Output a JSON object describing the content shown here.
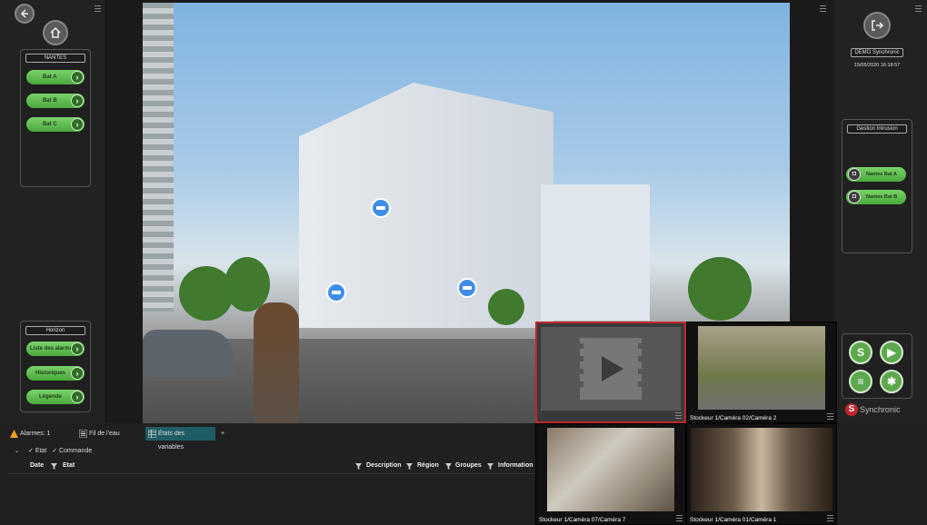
{
  "left": {
    "site_group_title": "NANTES",
    "site_buttons": [
      "Bat A",
      "Bat B",
      "Bat C"
    ],
    "horizon_title": "Horizon",
    "horizon_buttons": [
      "Liste des alarmes",
      "Historiques",
      "Légende"
    ]
  },
  "right": {
    "user_label": "DEMO Synchronic",
    "datetime": "15/05/2020 16:18:57",
    "intrusion_title": "Gestion Intrusion",
    "intrusion_buttons": [
      "Nantes Bat A",
      "Nantes Bat B"
    ],
    "brand": "Synchronic",
    "brand_colors": {
      "primary": "#c0272d",
      "text": "#bbbbbb"
    }
  },
  "bottom": {
    "tabs": [
      {
        "label": "Alarmes: 1",
        "icon": "warning-icon"
      },
      {
        "label": "Fil de l'eau",
        "icon": "list-icon"
      },
      {
        "label": "États des variables",
        "icon": "table-icon"
      },
      {
        "label": "+",
        "icon": ""
      }
    ],
    "filters": {
      "etat": "Etat",
      "commande": "Commande"
    },
    "columns": [
      "Date",
      "Etat",
      "Description",
      "Région",
      "Groupes",
      "Information"
    ]
  },
  "videos": [
    {
      "caption": "",
      "state": "placeholder"
    },
    {
      "caption": "Stockeur 1/Caméra 02/Caméra 2"
    },
    {
      "caption": "Stockeur 1/Caméra 07/Caméra 7"
    },
    {
      "caption": "Stockeur 1/Caméra 01/Caméra 1"
    }
  ],
  "colors": {
    "accent_green": "#5da84d",
    "active_tab": "#1f5c65",
    "selected_video_border": "#c0272d",
    "camera_marker": "#3f8ee6"
  }
}
